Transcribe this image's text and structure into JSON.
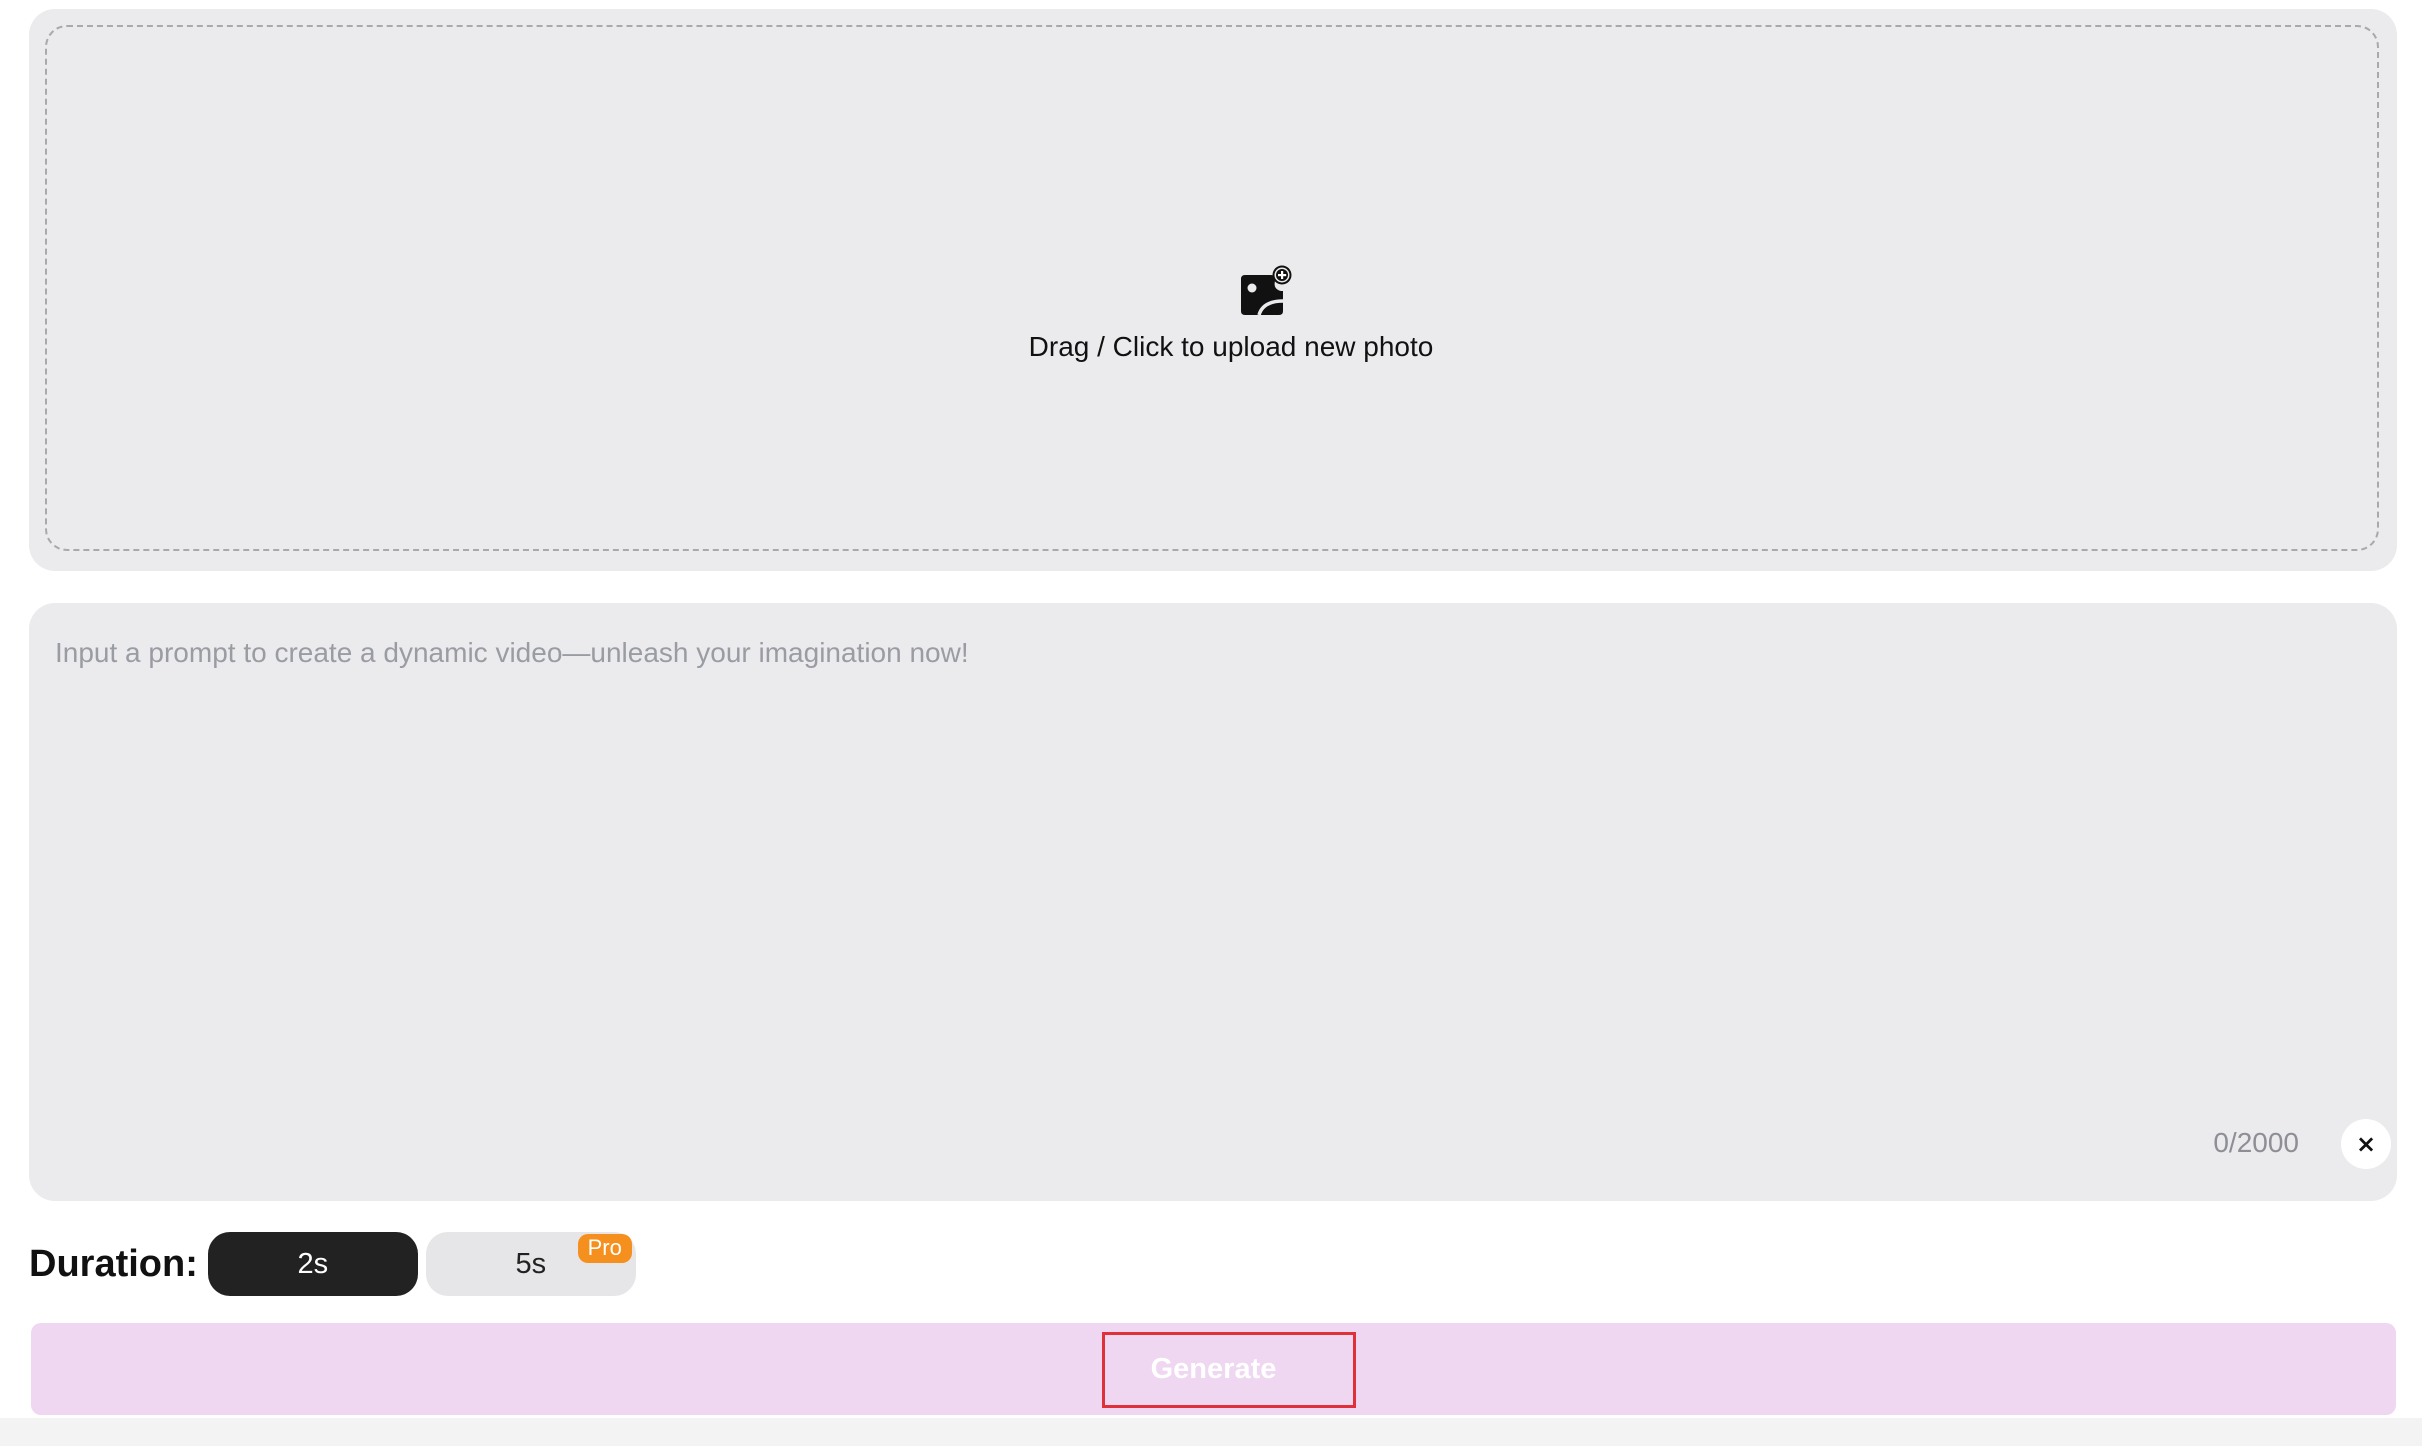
{
  "upload": {
    "label": "Drag / Click to upload new photo",
    "icon": "image-add-icon"
  },
  "prompt": {
    "placeholder": "Input a prompt to create a dynamic video—unleash your imagination now!",
    "value": "",
    "counter": "0/2000",
    "clear_icon": "×"
  },
  "duration": {
    "label": "Duration:",
    "options": [
      {
        "label": "2s",
        "selected": true
      },
      {
        "label": "5s",
        "selected": false,
        "badge": "Pro"
      }
    ]
  },
  "generate": {
    "label": "Generate"
  },
  "colors": {
    "accent_badge": "#f5901e",
    "generate_bg": "#efd6f1",
    "selected_option_bg": "#222222"
  }
}
